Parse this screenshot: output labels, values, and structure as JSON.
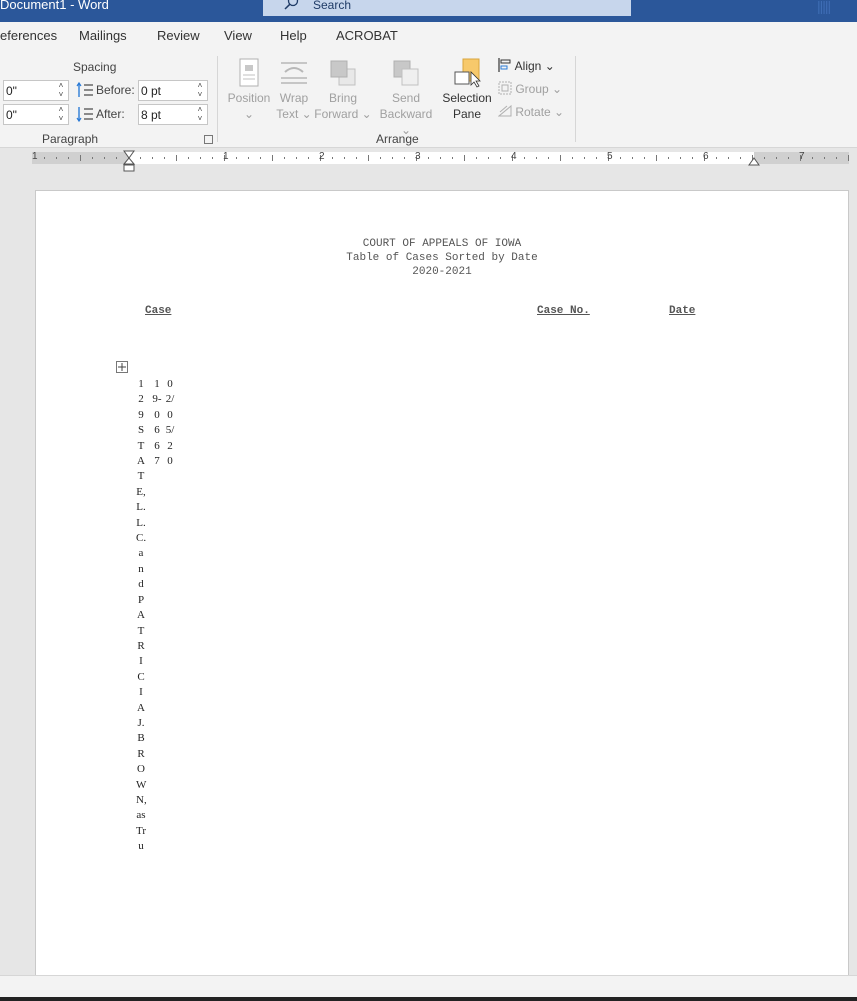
{
  "window": {
    "title": "Document1  -  Word"
  },
  "search": {
    "placeholder": "Search"
  },
  "tabs": [
    "eferences",
    "Mailings",
    "Review",
    "View",
    "Help",
    "ACROBAT"
  ],
  "paragraph_group": {
    "spacing_heading": "Spacing",
    "indent_left": "0\"",
    "indent_right": "0\"",
    "before_label": "Before:",
    "before_value": "0 pt",
    "after_label": "After:",
    "after_value": "8 pt",
    "group_label": "Paragraph"
  },
  "arrange_group": {
    "position": {
      "line1": "Position",
      "line2": "⌄"
    },
    "wrap_text": {
      "line1": "Wrap",
      "line2": "Text ⌄"
    },
    "bring_forward": {
      "line1": "Bring",
      "line2": "Forward ⌄"
    },
    "send_backward": {
      "line1": "Send",
      "line2": "Backward ⌄"
    },
    "selection_pane": {
      "line1": "Selection",
      "line2": "Pane"
    },
    "align": "Align ⌄",
    "group": "Group ⌄",
    "rotate": "Rotate ⌄",
    "group_label": "Arrange"
  },
  "ruler": {
    "numbers": [
      "1",
      "1",
      "2",
      "3",
      "4",
      "5",
      "6",
      "7"
    ]
  },
  "document": {
    "court": "COURT OF APPEALS OF IOWA",
    "subtitle": "Table of Cases Sorted by Date",
    "term": "2020-2021",
    "col_case": "Case",
    "col_case_no": "Case No.",
    "col_date": "Date",
    "row_case": "129STATE,L.L.C.andPATRICIAJ.BROWN,asTru",
    "row_case_no": "19-0667",
    "row_date": "02/05/20"
  },
  "colors": {
    "titlebar": "#2b579a",
    "selection_pane_icon": "#f7c96b"
  }
}
